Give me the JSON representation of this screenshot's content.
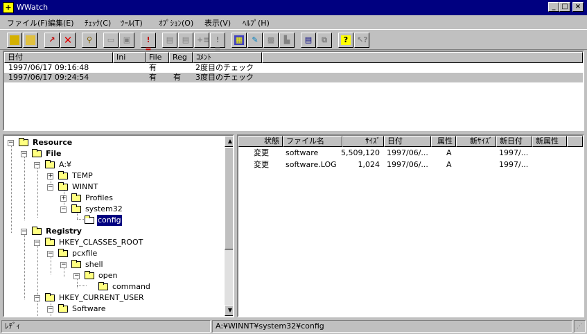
{
  "window": {
    "title": "WWatch",
    "icon": "app-icon"
  },
  "menu": [
    {
      "label": "ファイル(F)"
    },
    {
      "label": "編集(E)"
    },
    {
      "label": "ﾁｪｯｸ(C)"
    },
    {
      "label": "ﾂｰﾙ(T)"
    },
    {
      "label": "ｵﾌﾟｼｮﾝ(O)"
    },
    {
      "label": "表示(V)"
    },
    {
      "label": "ﾍﾙﾌﾟ(H)"
    }
  ],
  "history": {
    "columns": [
      "日付",
      "Ini",
      "File",
      "Reg",
      "ｺﾒﾝﾄ"
    ],
    "rows": [
      {
        "date": "1997/06/17  09:16:48",
        "ini": "",
        "file": "有",
        "reg": "",
        "comment": "2度目のチェック"
      },
      {
        "date": "1997/06/17  09:24:54",
        "ini": "",
        "file": "有",
        "reg": "有",
        "comment": "3度目のチェック"
      }
    ]
  },
  "tree": {
    "resource": "Resource",
    "file": "File",
    "drive": "A:¥",
    "temp": "TEMP",
    "winnt": "WINNT",
    "profiles": "Profiles",
    "system32": "system32",
    "config": "config",
    "registry": "Registry",
    "hkcr": "HKEY_CLASSES_ROOT",
    "pcxfile": "pcxfile",
    "shell": "shell",
    "open": "open",
    "command": "command",
    "hkcu": "HKEY_CURRENT_USER",
    "software": "Software"
  },
  "files": {
    "columns": [
      "状態",
      "ファイル名",
      "ｻｲｽﾞ",
      "日付",
      "属性",
      "新ｻｲｽﾞ",
      "新日付",
      "新属性"
    ],
    "rows": [
      {
        "state": "変更",
        "name": "software",
        "size": "5,509,120",
        "date": "1997/06/...",
        "attr": "A",
        "newsize": "",
        "newdate": "1997/...",
        "newattr": ""
      },
      {
        "state": "変更",
        "name": "software.LOG",
        "size": "1,024",
        "date": "1997/06/...",
        "attr": "A",
        "newsize": "",
        "newdate": "1997/...",
        "newattr": ""
      }
    ]
  },
  "status": {
    "message": "ﾚﾃﾞｨ",
    "path": "A:¥WINNT¥system32¥config"
  }
}
